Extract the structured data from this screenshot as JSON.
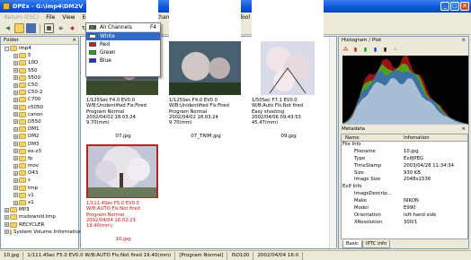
{
  "window": {
    "title": "DPEx - G:\\imp4\\DM2V"
  },
  "menu": [
    "Return (ESC)",
    "File",
    "View",
    "Edit",
    "SaturationCheck",
    "Channel",
    "Image Processing",
    "Tool",
    "Help"
  ],
  "dropdown": {
    "all": "All Channels",
    "all_shortcut": "F4",
    "items": [
      {
        "label": "White",
        "color": "#ffffff"
      },
      {
        "label": "Red",
        "color": "#d81818"
      },
      {
        "label": "Green",
        "color": "#18a818"
      },
      {
        "label": "Blue",
        "color": "#1830d8"
      }
    ]
  },
  "folder": {
    "header": "Folder",
    "items": [
      {
        "label": "imp4",
        "indent": 1,
        "exp": "-"
      },
      {
        "label": "5",
        "indent": 2,
        "exp": "+"
      },
      {
        "label": "10D",
        "indent": 2,
        "exp": "+"
      },
      {
        "label": "550",
        "indent": 2,
        "exp": "+"
      },
      {
        "label": "5500",
        "indent": 2,
        "exp": "+"
      },
      {
        "label": "C50",
        "indent": 2,
        "exp": "+"
      },
      {
        "label": "C50-2",
        "indent": 2,
        "exp": "+"
      },
      {
        "label": "C700",
        "indent": 2,
        "exp": "+"
      },
      {
        "label": "c5050",
        "indent": 2,
        "exp": "+"
      },
      {
        "label": "canon",
        "indent": 2,
        "exp": "+"
      },
      {
        "label": "D550",
        "indent": 2,
        "exp": "+"
      },
      {
        "label": "DM1",
        "indent": 2,
        "exp": "+"
      },
      {
        "label": "DM2",
        "indent": 2,
        "exp": "+"
      },
      {
        "label": "DM3",
        "indent": 2,
        "exp": "+"
      },
      {
        "label": "ex-z3",
        "indent": 2,
        "exp": "+"
      },
      {
        "label": "fp",
        "indent": 2,
        "exp": "+"
      },
      {
        "label": "mov",
        "indent": 2,
        "exp": "+"
      },
      {
        "label": "O43",
        "indent": 2,
        "exp": "+"
      },
      {
        "label": "s",
        "indent": 2,
        "exp": "+"
      },
      {
        "label": "tmp",
        "indent": 2,
        "exp": "+"
      },
      {
        "label": "v1",
        "indent": 2,
        "exp": "+"
      },
      {
        "label": "x1",
        "indent": 2,
        "exp": "+"
      },
      {
        "label": "MP3",
        "indent": 1,
        "exp": "+"
      },
      {
        "label": "msdownld.tmp",
        "indent": 1,
        "exp": "+"
      },
      {
        "label": "RECYCLER",
        "indent": 1,
        "exp": "+"
      },
      {
        "label": "System Volume Information",
        "indent": 1,
        "exp": "+"
      }
    ]
  },
  "thumbs": [
    {
      "name": "",
      "lines": [],
      "kind": "blank"
    },
    {
      "name": "",
      "lines": [],
      "kind": "blank"
    },
    {
      "name": "",
      "lines": [],
      "kind": "blank"
    },
    {
      "name": "07.jpg",
      "kind": "flowers",
      "lines": [
        "1/125Sec F4.0 EV0.0",
        "W/B:Unidentified Fls:Fired",
        "Program Normal",
        "2002/04/02 18:03:24",
        "9.70(mm)"
      ]
    },
    {
      "name": "07_TRIM.jpg",
      "kind": "flowers2",
      "lines": [
        "1/125Sec F4.0 EV0.0",
        "W/B:Unidentified Fls:Fired",
        "Program Normal",
        "2002/04/02 18:03:24",
        "9.70(mm)"
      ]
    },
    {
      "name": "09.jpg",
      "kind": "cherry",
      "lines": [
        "1/50Sec F7.1 EV0.0",
        "W/B:Auto Fls:Not fired",
        "Easy shooting",
        "2002/04/06 09:43:53",
        "45.47(mm)"
      ]
    },
    {
      "name": "10.jpg",
      "kind": "tree",
      "selected": true,
      "lines": [
        "1/111.4Sec F5.0 EV0.0",
        "W/B:AUTO Fls:Not fired",
        "Program Normal",
        "2002/04/04 16:02:23",
        "19.40(mm)"
      ]
    }
  ],
  "histogram": {
    "title": "Histogram / Plot",
    "values": [
      2,
      3,
      5,
      8,
      12,
      18,
      26,
      34,
      40,
      48,
      55,
      60,
      64,
      70,
      72,
      75,
      78,
      80,
      82,
      85,
      84,
      86,
      88,
      90,
      87,
      85,
      83,
      82,
      84,
      88,
      92,
      95,
      90,
      86,
      80,
      74,
      70,
      66,
      60,
      56,
      50,
      46,
      42,
      38,
      34,
      30,
      27,
      24,
      20,
      18,
      15,
      12,
      10,
      8,
      6,
      5,
      4,
      3,
      2,
      2
    ]
  },
  "metadata": {
    "title": "Metadata",
    "col_name": "Name",
    "col_info": "Infomation",
    "rows": [
      {
        "k": "File Info",
        "v": "",
        "group": true
      },
      {
        "k": "Filename",
        "v": "10.jpg"
      },
      {
        "k": "Type",
        "v": "ExifJPEG"
      },
      {
        "k": "TimeStamp",
        "v": "2003/04/28 11:34:34"
      },
      {
        "k": "Size",
        "v": "930 KB"
      },
      {
        "k": "Image Size",
        "v": "2048x1536"
      },
      {
        "k": "Exif Info",
        "v": "",
        "group": true
      },
      {
        "k": "ImageDescrip...",
        "v": ""
      },
      {
        "k": "Make",
        "v": "NIKON"
      },
      {
        "k": "Model",
        "v": "E990"
      },
      {
        "k": "Orientation",
        "v": "left-hand side"
      },
      {
        "k": "XResolution",
        "v": "300/1"
      }
    ],
    "tabs": [
      "Basic",
      "IPTC Info"
    ]
  },
  "status": [
    "10.jpg",
    "1/111.4Sec F5.0 EV0.0 W/B:AUTO Fls:Not fired 19.40(mm)",
    "[Program Normal]",
    "ISO100",
    "2002/04/04 16:0"
  ]
}
